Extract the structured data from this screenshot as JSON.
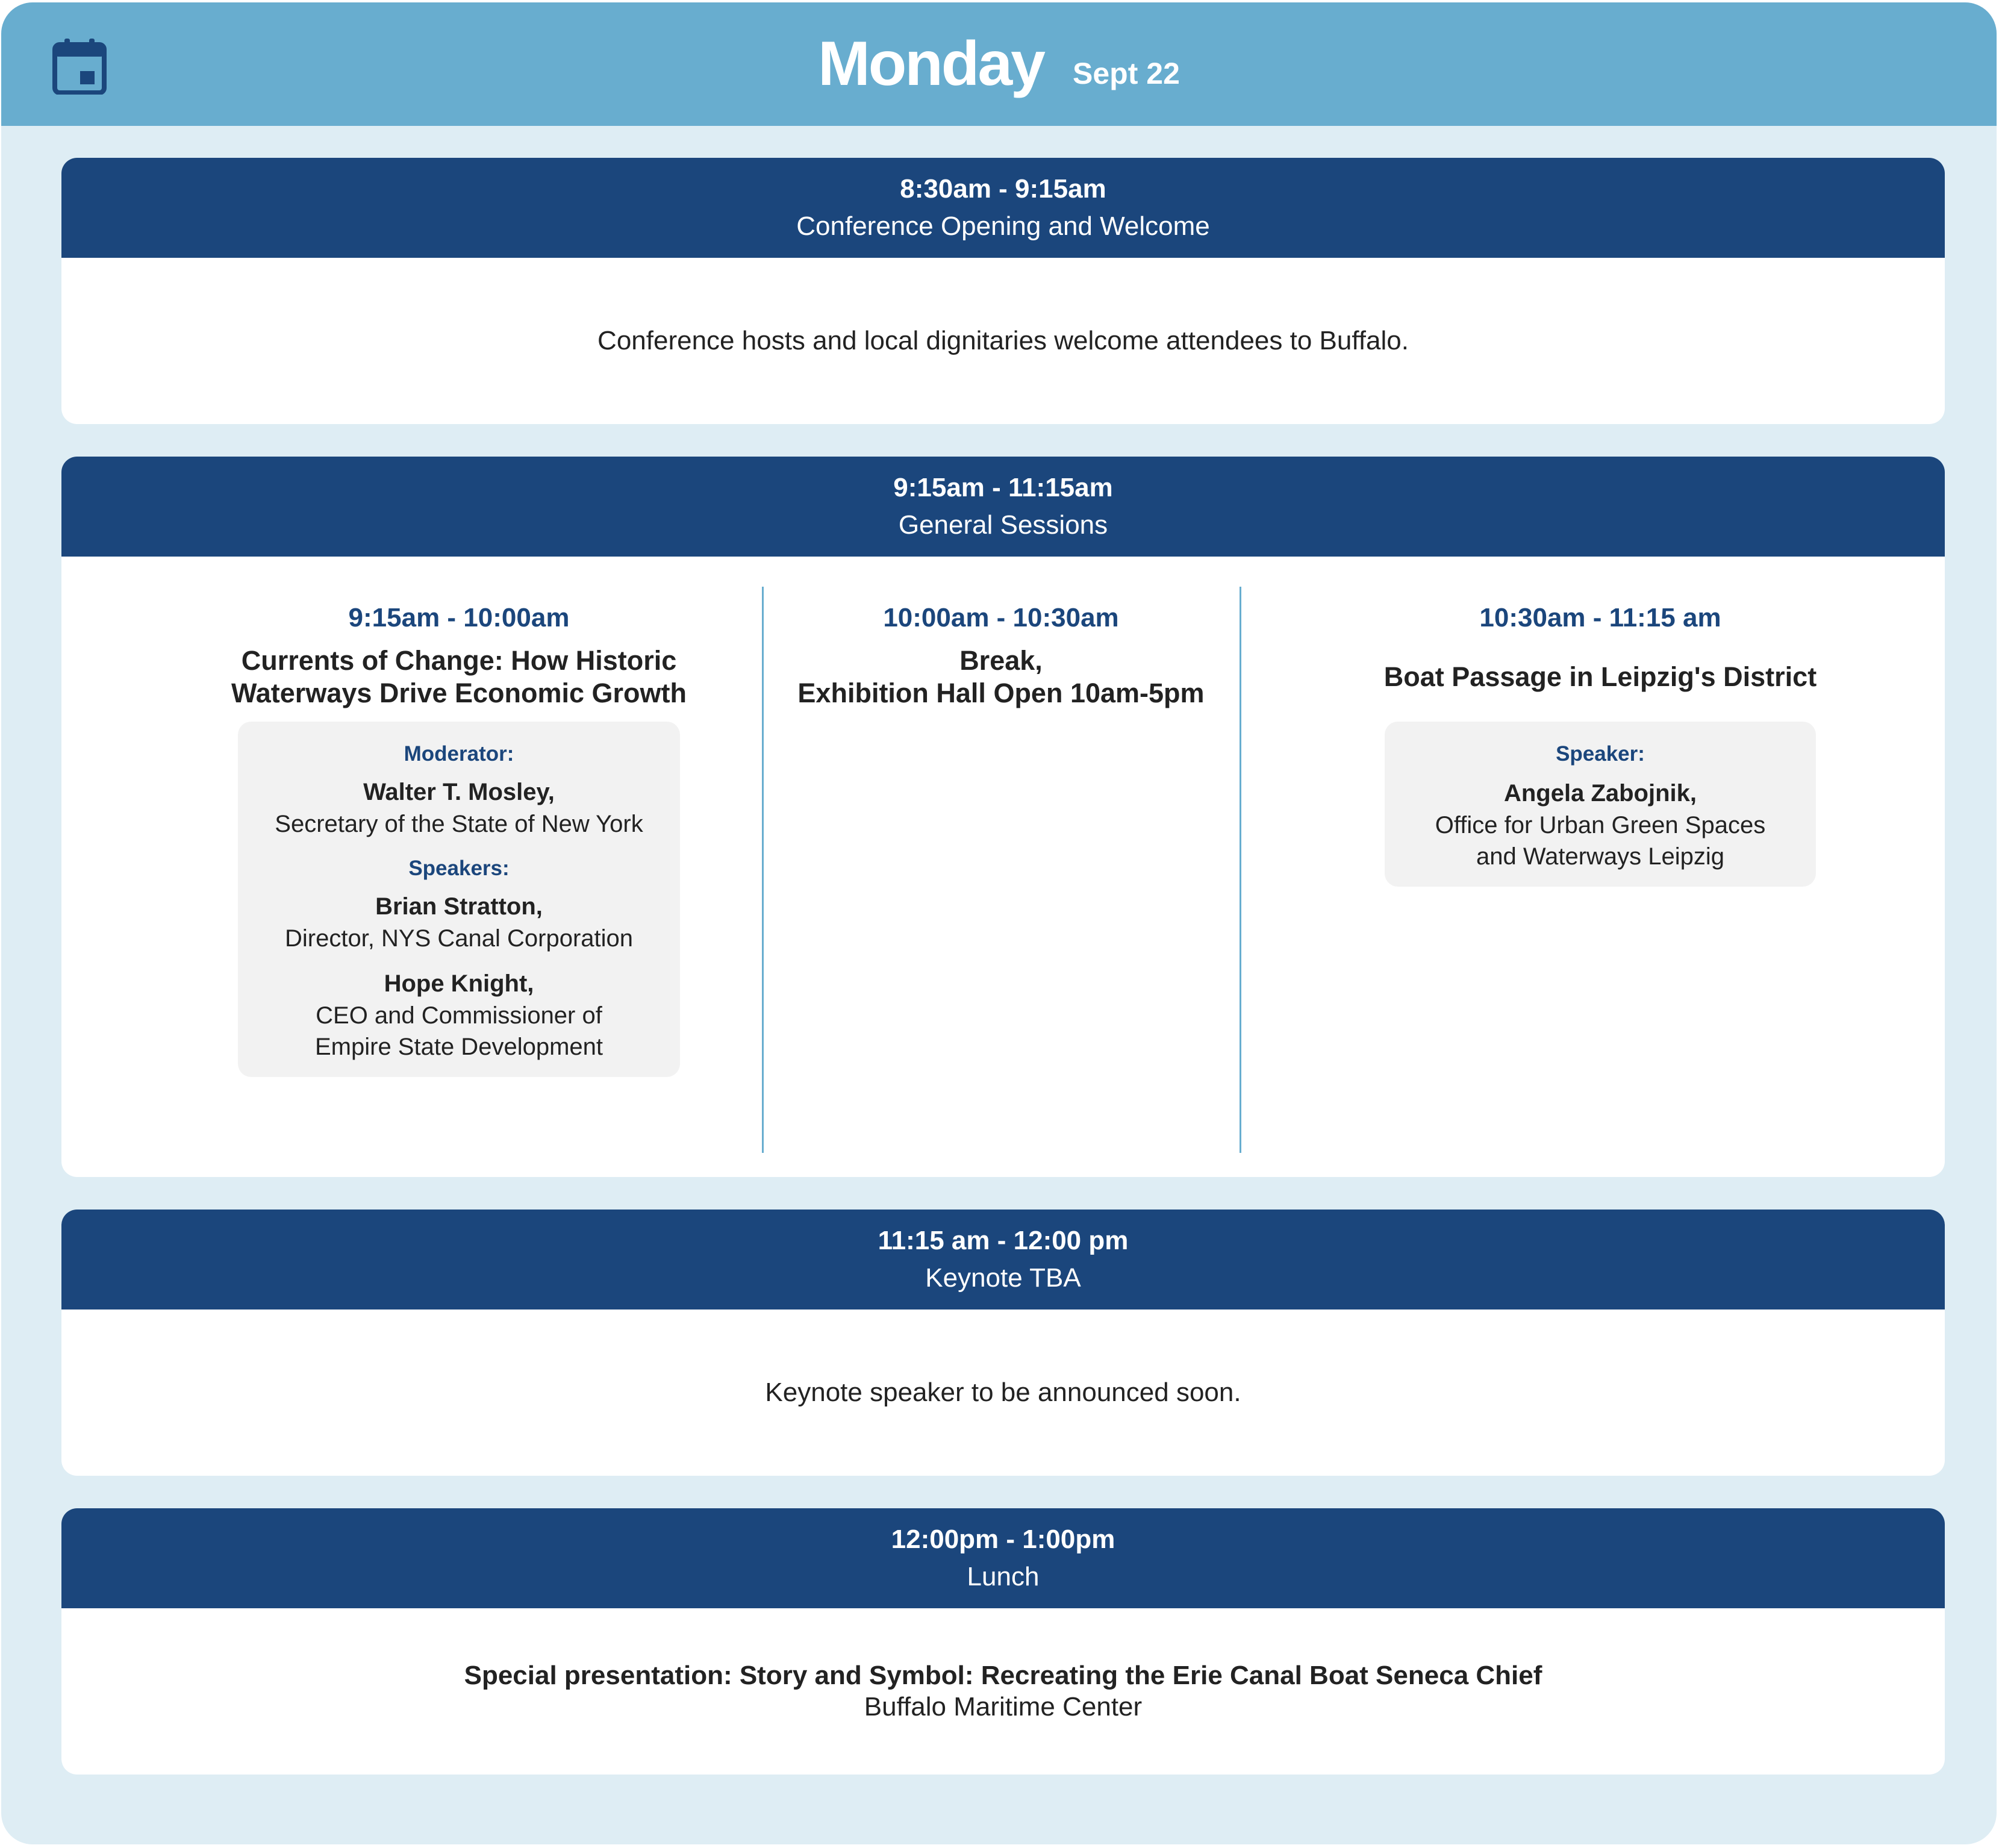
{
  "header": {
    "icon": "calendar-icon",
    "day": "Monday",
    "date": "Sept 22",
    "colors": {
      "header_bg": "#68adcf",
      "page_bg": "#deedf4",
      "navy": "#1b467c"
    }
  },
  "blocks": [
    {
      "time": "8:30am - 9:15am",
      "title": "Conference Opening and Welcome",
      "description": "Conference hosts and local dignitaries welcome attendees to Buffalo."
    },
    {
      "time": "9:15am - 11:15am",
      "title": "General Sessions",
      "sessions": [
        {
          "time": "9:15am - 10:00am",
          "title_lines": [
            "Currents of Change: How Historic",
            "Waterways Drive Economic Growth"
          ],
          "moderator_label": "Moderator:",
          "moderator": {
            "name": "Walter T. Mosley,",
            "affiliation": [
              "Secretary of the State of New York"
            ]
          },
          "speakers_label": "Speakers:",
          "speakers": [
            {
              "name": "Brian Stratton,",
              "affiliation": [
                "Director, NYS Canal Corporation"
              ]
            },
            {
              "name": "Hope Knight,",
              "affiliation": [
                "CEO and Commissioner of",
                "Empire State Development"
              ]
            }
          ]
        },
        {
          "time": "10:00am - 10:30am",
          "title_lines": [
            "Break,",
            "Exhibition Hall Open 10am-5pm"
          ]
        },
        {
          "time": "10:30am - 11:15 am",
          "title_lines": [
            "Boat Passage in Leipzig's District"
          ],
          "speakers_label": "Speaker:",
          "speakers": [
            {
              "name": "Angela Zabojnik,",
              "affiliation": [
                "Office for Urban Green Spaces",
                "and Waterways Leipzig"
              ]
            }
          ]
        }
      ]
    },
    {
      "time": "11:15 am - 12:00 pm",
      "title": "Keynote TBA",
      "description": "Keynote speaker to be announced soon."
    },
    {
      "time": "12:00pm - 1:00pm",
      "title": "Lunch",
      "presentation": "Special presentation: Story and Symbol: Recreating the Erie Canal Boat Seneca Chief",
      "location": "Buffalo Maritime Center"
    }
  ]
}
